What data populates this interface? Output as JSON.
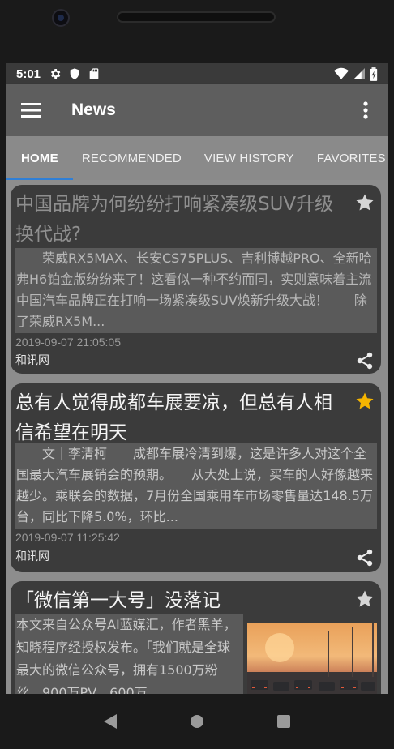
{
  "status_bar": {
    "time": "5:01",
    "left_icons": [
      "gear-icon",
      "shield-icon",
      "sd-card-icon"
    ],
    "right_icons": [
      "wifi-icon",
      "cell-signal-icon",
      "battery-icon"
    ]
  },
  "app_bar": {
    "title": "News",
    "menu_icon": "hamburger-menu-icon",
    "overflow_icon": "more-vert-icon"
  },
  "tabs": [
    {
      "label": "HOME",
      "active": true
    },
    {
      "label": "RECOMMENDED",
      "active": false
    },
    {
      "label": "VIEW HISTORY",
      "active": false
    },
    {
      "label": "FAVORITES",
      "active": false
    }
  ],
  "colors": {
    "accent": "#2f7fd6",
    "favorite_star": "#f5b400",
    "card_bg": "#3b3b3b"
  },
  "articles": [
    {
      "title": "中国品牌为何纷纷打响紧凑级SUV升级换代战?",
      "summary": "　　荣威RX5MAX、长安CS75PLUS、吉利博越PRO、全新哈弗H6铂金版纷纷来了！这看似一种不约而同，实则意味着主流中国汽车品牌正在打响一场紧凑级SUV焕新升级大战！　　除了荣威RX5M...",
      "date": "2019-09-07 21:05:05",
      "source": "和讯网",
      "favorited": false,
      "read": true
    },
    {
      "title": "总有人觉得成都车展要凉，但总有人相信希望在明天",
      "summary": "　　文｜李清柯　　成都车展冷清到爆，这是许多人对这个全国最大汽车展销会的预期。　　从大处上说，买车的人好像越来越少。乘联会的数据，7月份全国乘用车市场零售量达148.5万台，同比下降5.0%，环比...",
      "date": "2019-09-07 11:25:42",
      "source": "和讯网",
      "favorited": true,
      "read": false
    },
    {
      "title": "「微信第一大号」没落记",
      "summary": "本文来自公众号AI蓝媒汇，作者黑羊，知晓程序经授权发布。「我们就是全球最大的微信公众号，拥有1500万粉丝，900万PV，600万",
      "favorited": false,
      "read": false,
      "has_image": true
    }
  ],
  "nav_bar": [
    "back-icon",
    "home-icon",
    "recents-icon"
  ]
}
